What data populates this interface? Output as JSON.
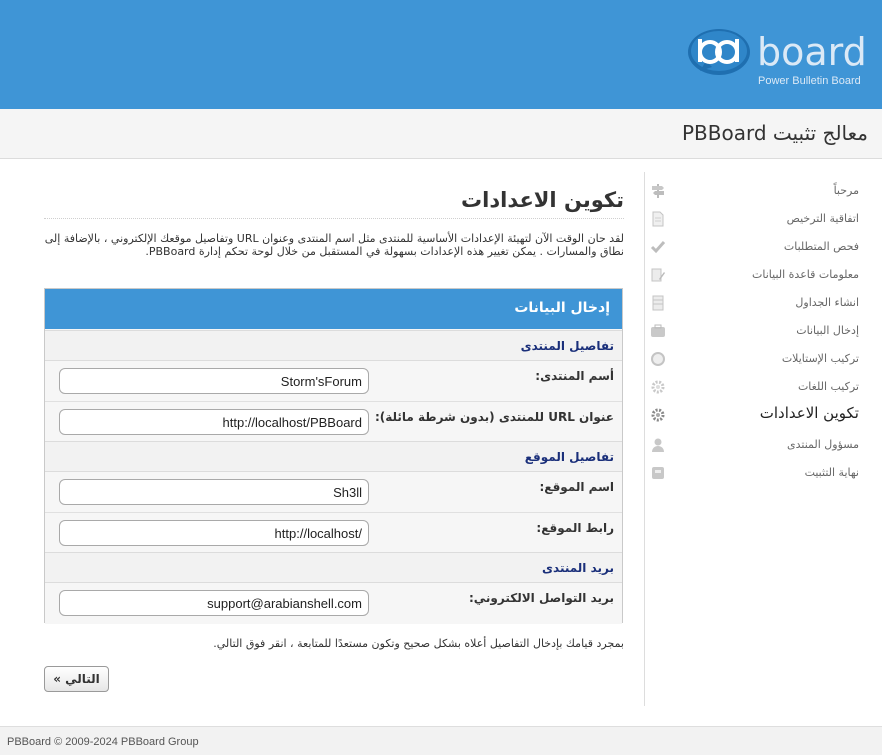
{
  "header": {
    "brand": "board",
    "tagline": "Power Bulletin Board",
    "color": "#3f95d6"
  },
  "titlebar": {
    "title": "معالج تثبيت PBBoard"
  },
  "sidebar": {
    "steps": [
      {
        "label": "مرحباً",
        "icon": "signpost-icon"
      },
      {
        "label": "اتفاقية الترخيص",
        "icon": "document-icon"
      },
      {
        "label": "فحص المتطلبات",
        "icon": "checkmark-icon"
      },
      {
        "label": "معلومات قاعدة البيانات",
        "icon": "edit-document-icon"
      },
      {
        "label": "انشاء الجداول",
        "icon": "table-icon"
      },
      {
        "label": "إدخال البيانات",
        "icon": "briefcase-icon"
      },
      {
        "label": "تركيب الإستايلات",
        "icon": "circle-icon"
      },
      {
        "label": "تركيب اللغات",
        "icon": "gear-icon"
      },
      {
        "label": "تكوين الاعدادات",
        "icon": "gear-icon",
        "active": true
      },
      {
        "label": "مسؤول المنتدى",
        "icon": "user-icon"
      },
      {
        "label": "نهاية التثبيت",
        "icon": "finish-icon"
      }
    ]
  },
  "main": {
    "heading": "تكوين الاعدادات",
    "intro": "لقد حان الوقت الآن لتهيئة الإعدادات الأساسية للمنتدى مثل اسم المنتدى وعنوان URL وتفاصيل موقعك الإلكتروني ، بالإضافة إلى نطاق والمسارات . يمكن تغيير هذه الإعدادات بسهولة في المستقبل من خلال لوحة تحكم إدارة PBBoard.",
    "form_title": "إدخال البيانات",
    "sections": {
      "forum": {
        "title": "تفاصيل المنتدى",
        "name_label": "أسم المنتدى:",
        "name_value": "Storm'sForum",
        "url_label": "عنوان URL للمنتدى (بدون شرطة مائلة):",
        "url_value": "http://localhost/PBBoard"
      },
      "site": {
        "title": "تفاصيل الموقع",
        "name_label": "اسم الموقع:",
        "name_value": "Sh3ll",
        "url_label": "رابط الموقع:",
        "url_value": "http://localhost/"
      },
      "email": {
        "title": "بريد المنتدى",
        "contact_label": "بريد التواصل الالكتروني:",
        "contact_value": "support@arabianshell.com"
      }
    },
    "after_text": "بمجرد قيامك بإدخال التفاصيل أعلاه بشكل صحيح وتكون مستعدًا للمتابعة ، انقر فوق التالي.",
    "next_label": "التالي »"
  },
  "footer": {
    "copyright": "PBBoard © 2009-2024 PBBoard Group"
  }
}
